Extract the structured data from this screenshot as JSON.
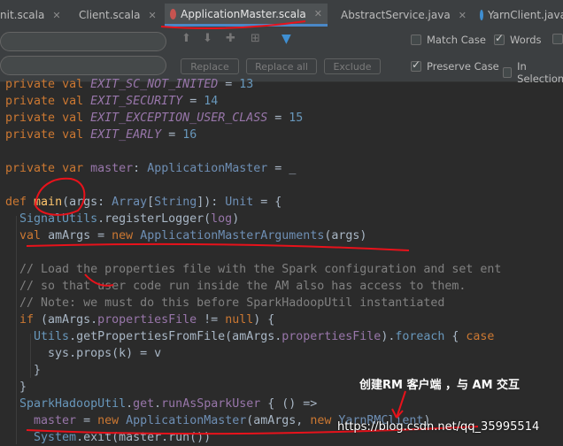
{
  "tabs": [
    {
      "label": "nit.scala"
    },
    {
      "label": "Client.scala"
    },
    {
      "label": "ApplicationMaster.scala"
    },
    {
      "label": "AbstractService.java"
    },
    {
      "label": "YarnClient.java"
    }
  ],
  "find": {
    "replace_label": "Replace",
    "replace_all_label": "Replace all",
    "exclude_label": "Exclude",
    "match_case_label": "Match Case",
    "words_label": "Words",
    "preserve_case_label": "Preserve Case",
    "in_selection_label": "In Selection"
  },
  "code": {
    "l1": [
      "private",
      "val",
      "EXIT_SC_NOT_INITED",
      "=",
      "13"
    ],
    "l2": [
      "private",
      "val",
      "EXIT_SECURITY",
      "=",
      "14"
    ],
    "l3": [
      "private",
      "val",
      "EXIT_EXCEPTION_USER_CLASS",
      "=",
      "15"
    ],
    "l4": [
      "private",
      "val",
      "EXIT_EARLY",
      "=",
      "16"
    ],
    "l6": [
      "private",
      "var",
      "master",
      ":",
      "ApplicationMaster",
      "=",
      "_"
    ],
    "l8": [
      "def",
      "main",
      "(args: ",
      "Array",
      "[",
      "String",
      "]): ",
      "Unit",
      " = {"
    ],
    "l9": [
      "SignalUtils",
      ".registerLogger(",
      "log",
      ")"
    ],
    "l10": [
      "val",
      "amArgs",
      " = ",
      "new",
      "ApplicationMasterArguments",
      "(args)"
    ],
    "l12": "// Load the properties file with the Spark configuration and set ent",
    "l13": "// so that user code run inside the AM also has access to them.",
    "l14": "// Note: we must do this before SparkHadoopUtil instantiated",
    "l15": [
      "if",
      " (amArgs.",
      "propertiesFile",
      " != ",
      "null",
      ") {"
    ],
    "l16": [
      "Utils",
      ".getPropertiesFromFile(amArgs.",
      "propertiesFile",
      ").",
      "foreach",
      " { ",
      "case"
    ],
    "l17": "sys.props(k) = v",
    "l18": "}",
    "l19": "}",
    "l20": [
      "SparkHadoopUtil",
      ".",
      "get",
      ".",
      "runAsSparkUser",
      " { () =>"
    ],
    "l21": [
      "master",
      " = ",
      "new",
      "ApplicationMaster",
      "(amArgs, ",
      "new",
      "YarnRMClient",
      ")"
    ],
    "l22": [
      "System",
      ".exit(master.run())"
    ]
  },
  "annotation": "创建RM 客户端 ，与 AM 交互",
  "watermark": "https://blog.csdn.net/qq_35995514",
  "colors": {
    "keyword": "#cc7832",
    "number": "#6897bb",
    "comment": "#808080",
    "field": "#9876aa",
    "annotation_red": "#e8121b"
  }
}
